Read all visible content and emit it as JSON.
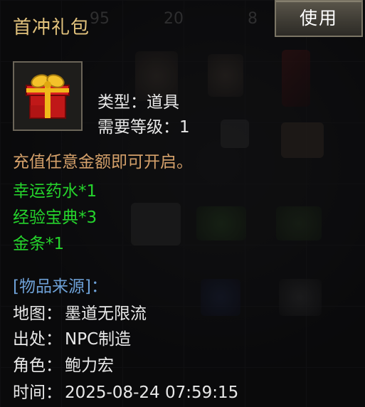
{
  "background": {
    "numbers": [
      "95",
      "20",
      "8"
    ]
  },
  "tooltip": {
    "title": "首冲礼包",
    "use_button": "使用",
    "icon": "gift-box-icon",
    "type_label": "类型：",
    "type_value": "道具",
    "level_label": "需要等级：",
    "level_value": "1",
    "description": "充值任意金额即可开启。",
    "rewards": [
      "幸运药水*1",
      "经验宝典*3",
      "金条*1"
    ],
    "source_header": "[物品来源]：",
    "map_label": "地图：",
    "map_value": "墨道无限流",
    "origin_label": "出处：",
    "origin_value": "NPC制造",
    "role_label": "角色：",
    "role_value": "鲍力宏",
    "time_label": "时间：",
    "time_value": "2025-08-24 07:59:15"
  },
  "colors": {
    "title": "#e2c27c",
    "description": "#d4a06a",
    "reward": "#25d42c",
    "source": "#6da0d6"
  }
}
